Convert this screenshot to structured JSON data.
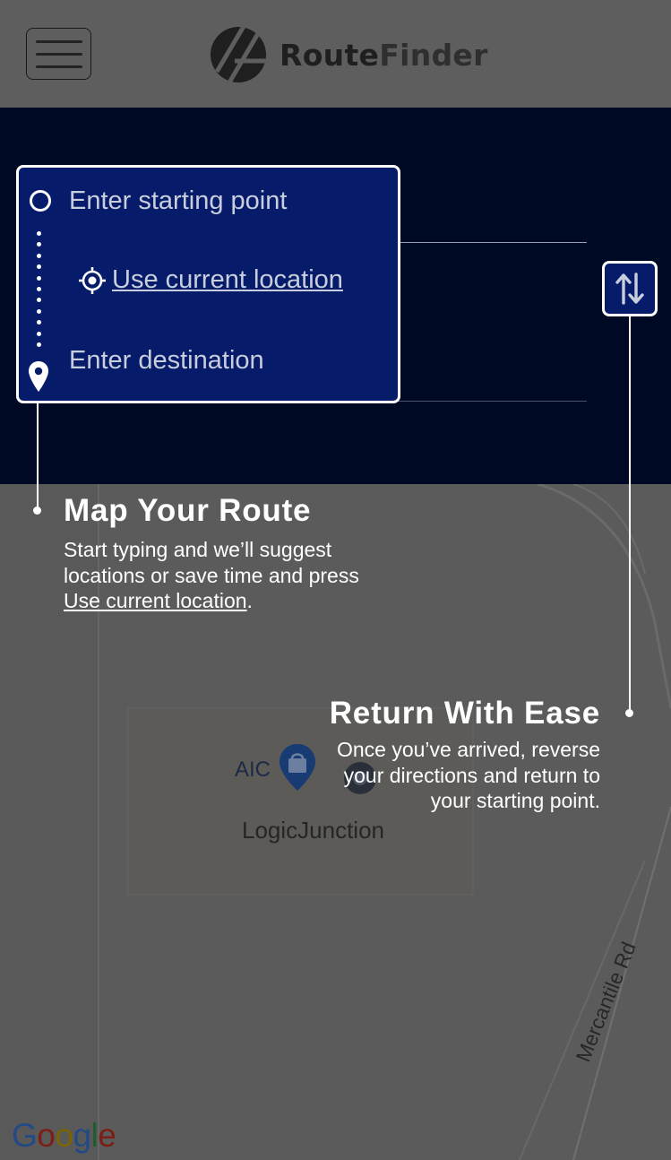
{
  "header": {
    "menu_icon": "hamburger-menu-icon",
    "logo_icon": "routefinder-logo-icon",
    "brand_part1": "Route",
    "brand_part2": "Finder",
    "brand_color_part1": "#1f1f1f",
    "brand_color_part2": "#2f2f2f"
  },
  "search": {
    "start_placeholder": "Enter starting point",
    "current_location_label": "Use current location",
    "current_location_icon": "crosshair-target-icon",
    "destination_placeholder": "Enter destination",
    "start_icon": "circle-start-icon",
    "destination_icon": "map-pin-icon",
    "swap_icon": "swap-up-down-arrows-icon",
    "panel_color": "#000924",
    "box_color": "#061c6b"
  },
  "callouts": {
    "map_route": {
      "title": "Map Your Route",
      "body_before": "Start typing and we’ll suggest locations or save time and press ",
      "body_link": "Use current location",
      "body_after": "."
    },
    "return": {
      "title": "Return With Ease",
      "body": "Once you’ve arrived, reverse your directions and return to your starting point."
    }
  },
  "map": {
    "poi_aic_label": "AIC",
    "poi_aic_icon": "shopping-bag-pin-icon",
    "poi_logicjunction_label": "LogicJunction",
    "street_label": "Mercantile Rd",
    "attribution": [
      "G",
      "o",
      "o",
      "g",
      "l",
      "e"
    ]
  }
}
